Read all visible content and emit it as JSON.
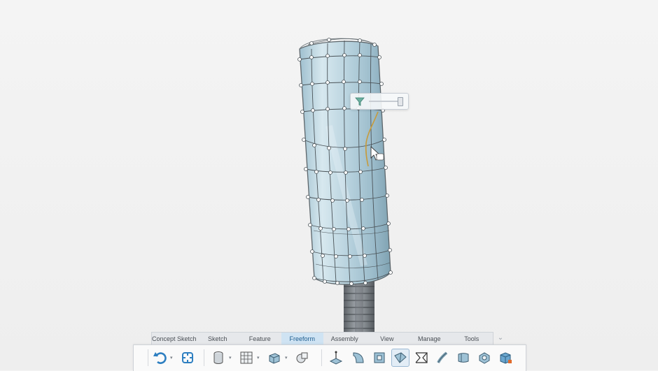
{
  "ribbon": {
    "tabs": [
      {
        "label": "Concept Sketch",
        "active": false
      },
      {
        "label": "Sketch",
        "active": false
      },
      {
        "label": "Feature",
        "active": false
      },
      {
        "label": "Freeform",
        "active": true
      },
      {
        "label": "Assembly",
        "active": false
      },
      {
        "label": "View",
        "active": false
      },
      {
        "label": "Manage",
        "active": false
      },
      {
        "label": "Tools",
        "active": false
      }
    ]
  },
  "toolbar": {
    "tools": [
      {
        "icon": "undo-icon",
        "has_dropdown": true
      },
      {
        "icon": "regenerate-icon",
        "has_dropdown": false
      },
      {
        "icon": "cylinder-icon",
        "has_dropdown": true
      },
      {
        "icon": "plane-grid-icon",
        "has_dropdown": true
      },
      {
        "icon": "extrude-box-icon",
        "has_dropdown": true
      },
      {
        "icon": "boolean-shape-icon",
        "has_dropdown": false
      },
      {
        "icon": "edit-point-icon",
        "has_dropdown": false
      },
      {
        "icon": "bend-surface-icon",
        "has_dropdown": false
      },
      {
        "icon": "frame-icon",
        "has_dropdown": false
      },
      {
        "icon": "sculpt-icon",
        "has_dropdown": false,
        "selected": true
      },
      {
        "icon": "bridge-icon",
        "has_dropdown": false
      },
      {
        "icon": "sweep-icon",
        "has_dropdown": false
      },
      {
        "icon": "thicken-icon",
        "has_dropdown": false
      },
      {
        "icon": "shell-icon",
        "has_dropdown": false
      },
      {
        "icon": "cube-icon",
        "has_dropdown": false
      }
    ]
  },
  "colors": {
    "surface": "#b9d3df",
    "cage_line": "#4b5358",
    "active_edge": "#c79b3b",
    "tab_active": "#cfe3f3",
    "accent": "#2e7fc1"
  },
  "slider": {
    "value": 0.9
  }
}
